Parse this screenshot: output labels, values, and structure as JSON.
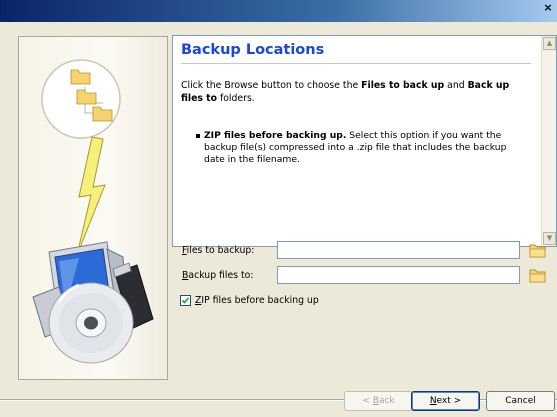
{
  "window": {
    "close_glyph": "×"
  },
  "page": {
    "heading": "Backup Locations",
    "intro_pre": "Click the Browse button to choose the ",
    "intro_bold1": "Files to back up",
    "intro_mid": " and ",
    "intro_bold2": "Back up files to",
    "intro_post": " folders.",
    "bullet_bold": "ZIP files before backing up.",
    "bullet_text": " Select this option if you want the backup file(s) compressed into a .zip file that includes the backup date in the filename."
  },
  "form": {
    "files_to_backup": {
      "label_accel": "F",
      "label_rest": "iles to backup:",
      "value": ""
    },
    "backup_files_to": {
      "label_accel": "B",
      "label_rest": "ackup files to:",
      "value": ""
    },
    "zip_checkbox": {
      "label_accel": "Z",
      "label_rest": "IP files before backing up",
      "checked": true
    }
  },
  "buttons": {
    "back": {
      "prefix": "< ",
      "accel": "B",
      "rest": "ack"
    },
    "next": {
      "accel": "N",
      "rest": "ext >"
    },
    "cancel": "Cancel"
  },
  "icons": {
    "scroll_up": "scroll-up-arrow-icon",
    "scroll_down": "scroll-down-arrow-icon",
    "browse": "folder-icon",
    "illustration": "computer-backup-illustration"
  }
}
